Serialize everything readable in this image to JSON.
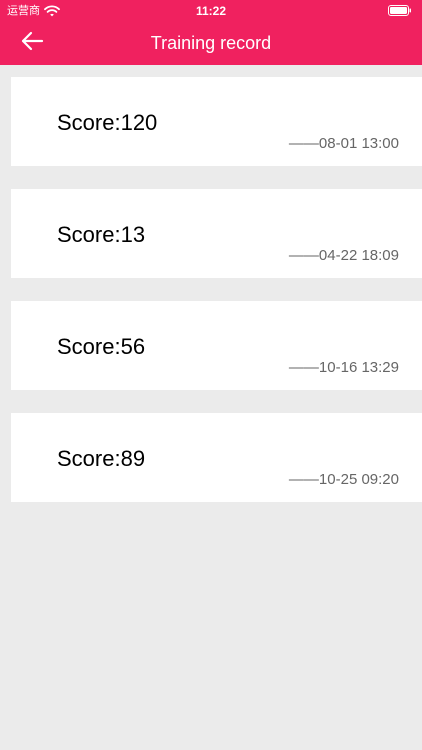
{
  "status_bar": {
    "carrier": "运营商",
    "time": "11:22"
  },
  "nav": {
    "title": "Training record"
  },
  "records": [
    {
      "score": "Score:120",
      "time": "——08-01 13:00"
    },
    {
      "score": "Score:13",
      "time": "——04-22 18:09"
    },
    {
      "score": "Score:56",
      "time": "——10-16 13:29"
    },
    {
      "score": "Score:89",
      "time": "——10-25 09:20"
    }
  ],
  "colors": {
    "brand": "#f0215f",
    "background": "#ebebeb",
    "card": "#ffffff",
    "score_text": "#000000",
    "time_text": "#666666"
  },
  "icons": {
    "back": "arrow-left-icon",
    "wifi": "wifi-icon",
    "battery": "battery-icon"
  }
}
